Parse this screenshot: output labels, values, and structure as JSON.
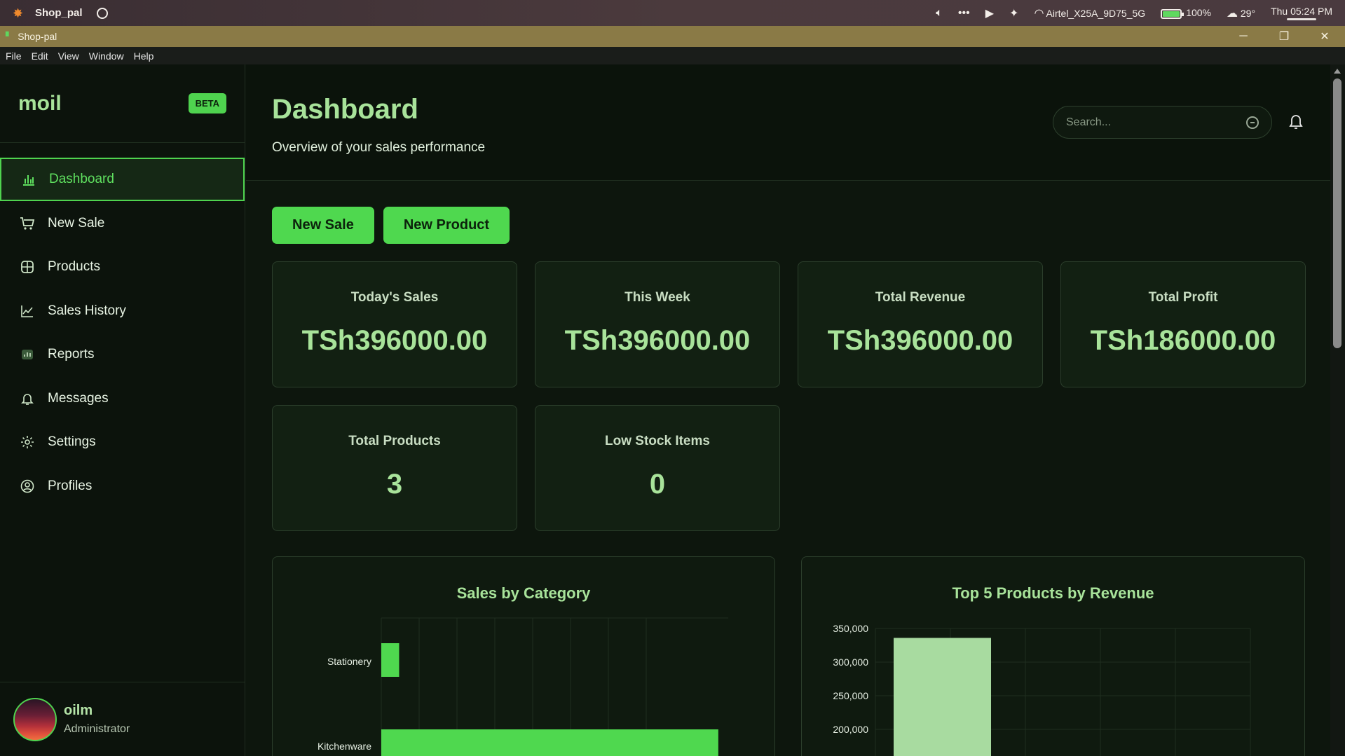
{
  "os_bar": {
    "app_name": "Shop_pal",
    "wifi_name": "Airtel_X25A_9D75_5G",
    "battery": "100%",
    "battery_level": 1.0,
    "weather": "29°",
    "clock": "Thu 05:24 PM"
  },
  "window": {
    "title": "Shop-pal",
    "controls": [
      "─",
      "❐",
      "✕"
    ]
  },
  "menu": [
    "File",
    "Edit",
    "View",
    "Window",
    "Help"
  ],
  "sidebar": {
    "brand": "moil",
    "badge": "BETA",
    "items": [
      {
        "label": "Dashboard",
        "icon": "bar-chart-icon",
        "active": true
      },
      {
        "label": "New Sale",
        "icon": "cart-icon"
      },
      {
        "label": "Products",
        "icon": "box-icon"
      },
      {
        "label": "Sales History",
        "icon": "line-chart-icon"
      },
      {
        "label": "Reports",
        "icon": "report-icon"
      },
      {
        "label": "Messages",
        "icon": "bell-icon"
      },
      {
        "label": "Settings",
        "icon": "gear-icon"
      },
      {
        "label": "Profiles",
        "icon": "user-circle-icon"
      }
    ],
    "user": {
      "name": "oilm",
      "role": "Administrator"
    }
  },
  "header": {
    "title": "Dashboard",
    "subtitle": "Overview of your sales performance",
    "search_placeholder": "Search..."
  },
  "actions": {
    "new_sale": "New Sale",
    "new_product": "New Product"
  },
  "stats": [
    {
      "label": "Today's Sales",
      "value": "TSh396000.00"
    },
    {
      "label": "This Week",
      "value": "TSh396000.00"
    },
    {
      "label": "Total Revenue",
      "value": "TSh396000.00"
    },
    {
      "label": "Total Profit",
      "value": "TSh186000.00"
    },
    {
      "label": "Total Products",
      "value": "3"
    },
    {
      "label": "Low Stock Items",
      "value": "0"
    }
  ],
  "colors": {
    "accent": "#4fd84f",
    "accent_text": "#a8e39a",
    "bar_light": "#a8dba0",
    "background": "#0d160d"
  },
  "chart_data": [
    {
      "type": "bar",
      "orientation": "horizontal",
      "title": "Sales by Category",
      "categories": [
        "Stationery",
        "Kitchenware"
      ],
      "values": [
        18000,
        340000
      ],
      "xlim": [
        0,
        350000
      ],
      "grid": true,
      "bar_color": "#4fd84f"
    },
    {
      "type": "bar",
      "title": "Top 5 Products by Revenue",
      "categories": [
        ""
      ],
      "values": [
        336000
      ],
      "yticks": [
        "350,000",
        "300,000",
        "250,000",
        "200,000"
      ],
      "ytick_values": [
        350000,
        300000,
        250000,
        200000
      ],
      "ylim": [
        0,
        350000
      ],
      "grid": true,
      "bar_color": "#a8dba0"
    }
  ]
}
